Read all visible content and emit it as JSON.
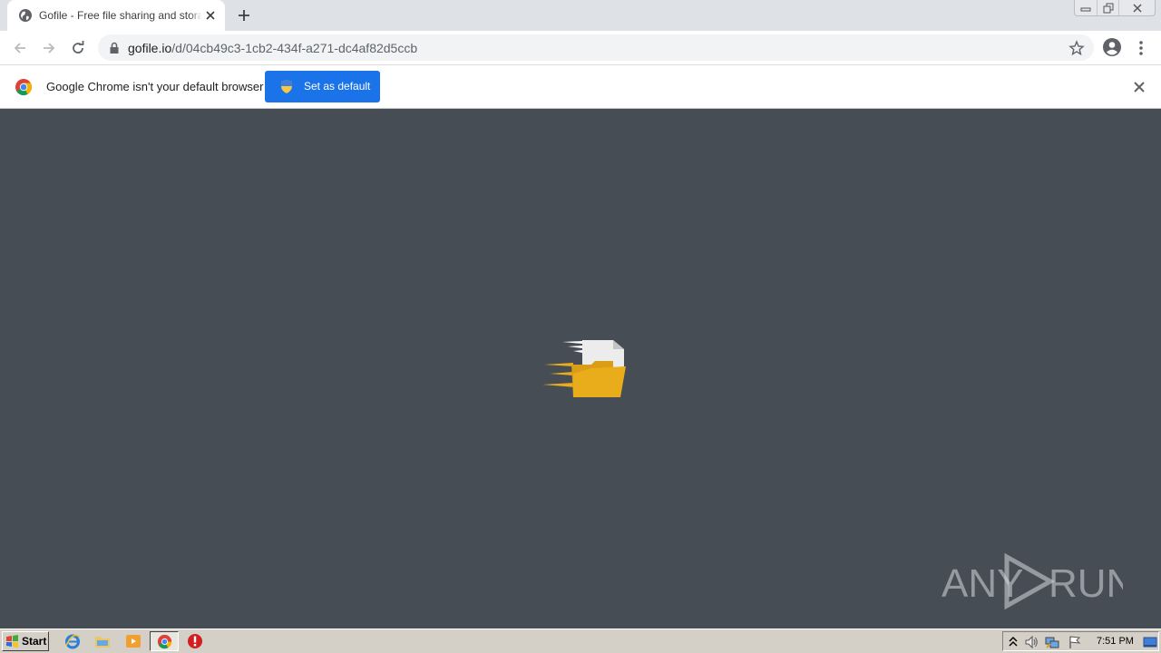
{
  "browser": {
    "tab": {
      "title": "Gofile - Free file sharing and storage",
      "favicon": "globe-icon"
    },
    "address_bar": {
      "domain": "gofile.io",
      "path": "/d/04cb49c3-1cb2-434f-a271-dc4af82d5ccb"
    },
    "infobar": {
      "message": "Google Chrome isn't your default browser",
      "button_label": "Set as default"
    }
  },
  "page": {
    "state": "loading",
    "loader_icon": "flying-folder-icon",
    "watermark": "ANY RUN"
  },
  "taskbar": {
    "start_label": "Start",
    "clock": "7:51 PM",
    "pinned": [
      "internet-explorer-icon",
      "explorer-folder-icon",
      "media-player-icon",
      "chrome-icon",
      "stop-icon"
    ]
  },
  "colors": {
    "page_background": "#464d55",
    "accent_button": "#1a73e8",
    "folder": "#e9ad1c"
  }
}
